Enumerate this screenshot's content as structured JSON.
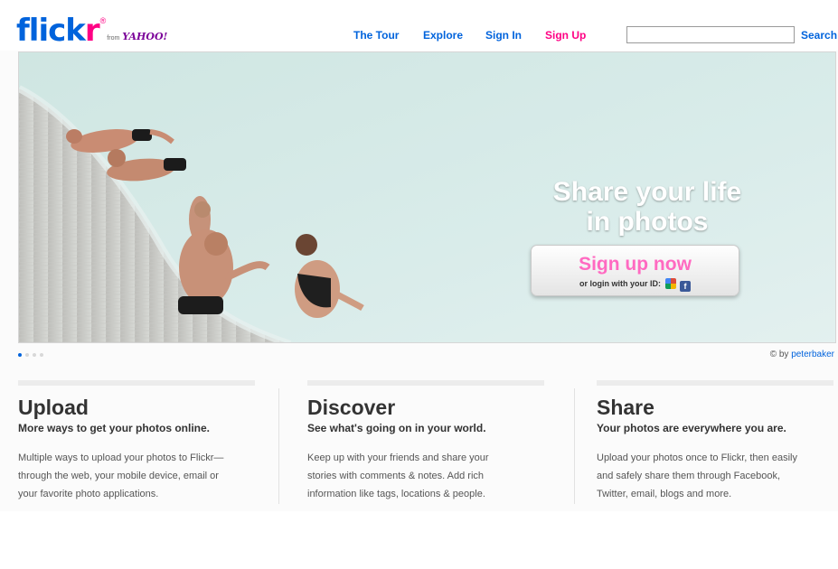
{
  "header": {
    "logo": {
      "word_a": "flick",
      "word_b": "r",
      "registered": "®",
      "from": "from",
      "yahoo": "YAHOO!"
    },
    "nav": [
      {
        "label": "The Tour"
      },
      {
        "label": "Explore"
      },
      {
        "label": "Sign In"
      },
      {
        "label": "Sign Up"
      }
    ],
    "search": {
      "placeholder": "",
      "value": "",
      "button_label": "Search"
    }
  },
  "hero": {
    "tagline_line1": "Share your life",
    "tagline_line2": "in photos",
    "cta_label": "Sign up now",
    "cta_sub": "or login with your ID:",
    "login_icons": [
      "google-icon",
      "facebook-icon"
    ],
    "carousel": {
      "count": 4,
      "active": 1
    },
    "credit_prefix": "© by",
    "credit_user": "peterbaker"
  },
  "features": [
    {
      "title": "Upload",
      "subtitle": "More ways to get your photos online.",
      "body_lines": [
        "Multiple ways to upload your photos to Flickr—",
        "through the web, your mobile device, email or",
        "your favorite photo applications."
      ]
    },
    {
      "title": "Discover",
      "subtitle": "See what's going on in your world.",
      "body_lines": [
        "Keep up with your friends and share your",
        "stories with comments & notes. Add rich",
        "information like tags, locations & people."
      ]
    },
    {
      "title": "Share",
      "subtitle": "Your photos are everywhere you are.",
      "body_lines": [
        "Upload your photos once to Flickr, then easily",
        "and safely share them through Facebook,",
        "Twitter, email, blogs and more."
      ]
    }
  ],
  "colors": {
    "brand_blue": "#0063dc",
    "brand_pink": "#ff0084",
    "cta_pink": "#ff6ac1",
    "water": "#d3e7e3"
  }
}
